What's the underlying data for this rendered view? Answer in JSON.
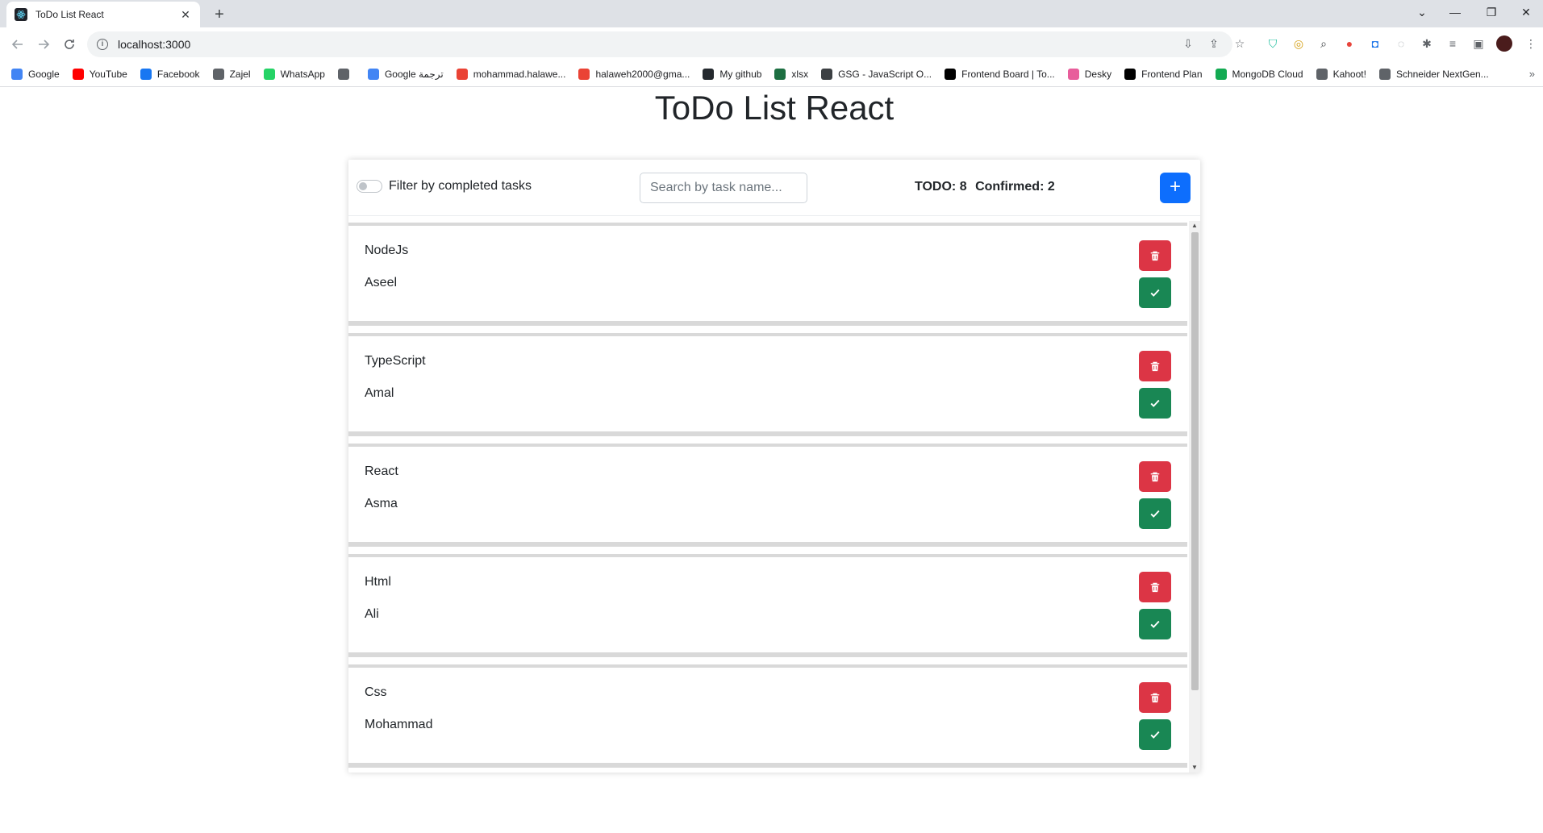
{
  "browser": {
    "tab_title": "ToDo List React",
    "tab_close": "✕",
    "new_tab": "+",
    "url": "localhost:3000",
    "window_controls": [
      "⌄",
      "—",
      "❐",
      "✕"
    ]
  },
  "bookmarks": [
    {
      "label": "Google",
      "icon": "google-icon",
      "color": "#4285f4"
    },
    {
      "label": "YouTube",
      "icon": "youtube-icon",
      "color": "#ff0000"
    },
    {
      "label": "Facebook",
      "icon": "facebook-icon",
      "color": "#1877f2"
    },
    {
      "label": "Zajel",
      "icon": "globe-icon",
      "color": "#5f6368"
    },
    {
      "label": "WhatsApp",
      "icon": "whatsapp-icon",
      "color": "#25d366"
    },
    {
      "label": "",
      "icon": "globe-icon",
      "color": "#5f6368"
    },
    {
      "label": "Google ترجمة",
      "icon": "translate-icon",
      "color": "#4285f4"
    },
    {
      "label": "mohammad.halawe...",
      "icon": "gmail-icon",
      "color": "#ea4335"
    },
    {
      "label": "halaweh2000@gma...",
      "icon": "gmail-icon",
      "color": "#ea4335"
    },
    {
      "label": "My github",
      "icon": "github-icon",
      "color": "#24292e"
    },
    {
      "label": "xlsx",
      "icon": "excel-icon",
      "color": "#1d6f42"
    },
    {
      "label": "GSG - JavaScript O...",
      "icon": "classroom-icon",
      "color": "#3c4043"
    },
    {
      "label": "Frontend Board | To...",
      "icon": "notion-icon",
      "color": "#000000"
    },
    {
      "label": "Desky",
      "icon": "desky-icon",
      "color": "#e85d9b"
    },
    {
      "label": "Frontend Plan",
      "icon": "notion-icon",
      "color": "#000000"
    },
    {
      "label": "MongoDB Cloud",
      "icon": "mongodb-icon",
      "color": "#13aa52"
    },
    {
      "label": "Kahoot!",
      "icon": "globe-icon",
      "color": "#5f6368"
    },
    {
      "label": "Schneider NextGen...",
      "icon": "globe-icon",
      "color": "#5f6368"
    }
  ],
  "bookmarks_more": "»",
  "app": {
    "title": "ToDo List React",
    "filter_label": "Filter by completed tasks",
    "search_placeholder": "Search by task name...",
    "todo_label": "TODO: 8",
    "confirmed_label": "Confirmed: 2",
    "add_symbol": "+",
    "colors": {
      "primary": "#0d6efd",
      "danger": "#dc3545",
      "success": "#198754"
    }
  },
  "tasks": [
    {
      "task": "NodeJs",
      "person": "Aseel"
    },
    {
      "task": "TypeScript",
      "person": "Amal"
    },
    {
      "task": "React",
      "person": "Asma"
    },
    {
      "task": "Html",
      "person": "Ali"
    },
    {
      "task": "Css",
      "person": "Mohammad"
    }
  ]
}
